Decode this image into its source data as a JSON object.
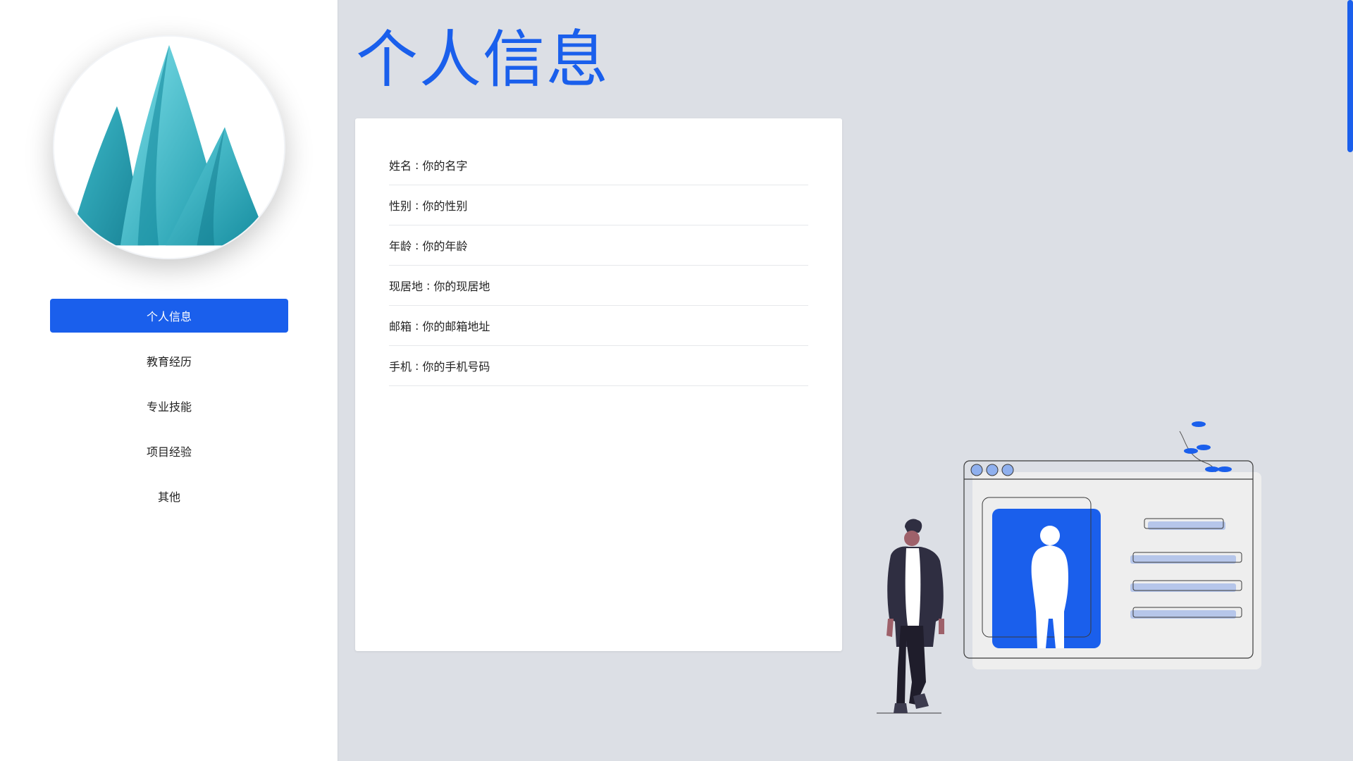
{
  "page": {
    "title": "个人信息",
    "accent_color": "#1a5fec"
  },
  "avatar": {
    "icon": "mountain-avatar-icon"
  },
  "nav": {
    "items": [
      {
        "label": "个人信息",
        "active": true
      },
      {
        "label": "教育经历",
        "active": false
      },
      {
        "label": "专业技能",
        "active": false
      },
      {
        "label": "项目经验",
        "active": false
      },
      {
        "label": "其他",
        "active": false
      }
    ]
  },
  "info": {
    "rows": [
      {
        "label": "姓名",
        "sep": ":",
        "value": "你的名字"
      },
      {
        "label": "性别",
        "sep": ":",
        "value": "你的性别"
      },
      {
        "label": "年龄",
        "sep": ":",
        "value": "你的年龄"
      },
      {
        "label": "现居地",
        "sep": ":",
        "value": "你的现居地"
      },
      {
        "label": "邮箱",
        "sep": ":",
        "value": "你的邮箱地址"
      },
      {
        "label": "手机",
        "sep": ":",
        "value": "你的手机号码"
      }
    ]
  },
  "illustration": {
    "icon": "profile-browser-illustration-icon"
  }
}
